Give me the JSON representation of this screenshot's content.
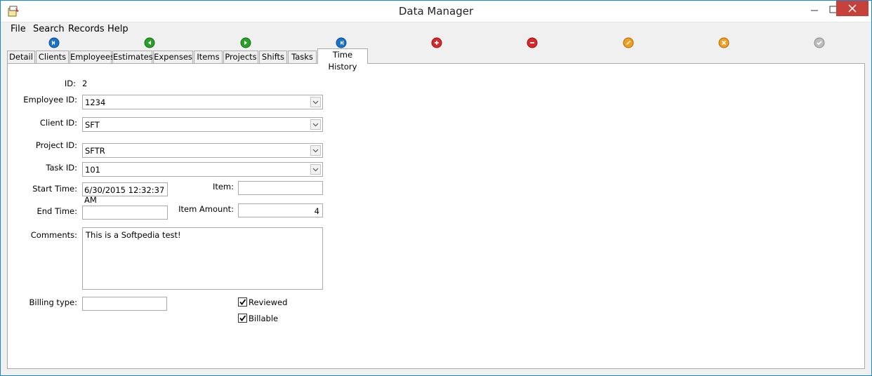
{
  "window": {
    "title": "Data Manager"
  },
  "menu": [
    "File",
    "Search",
    "Records",
    "Help"
  ],
  "navbar": [
    {
      "name": "first-record-icon",
      "color": "#1a72c9"
    },
    {
      "name": "previous-record-icon",
      "color": "#2aa02a"
    },
    {
      "name": "next-record-icon",
      "color": "#2aa02a"
    },
    {
      "name": "last-record-icon",
      "color": "#1a72c9"
    },
    {
      "name": "add-record-icon",
      "color": "#d62a2a"
    },
    {
      "name": "delete-record-icon",
      "color": "#d62a2a"
    },
    {
      "name": "edit-record-icon",
      "color": "#f0a020"
    },
    {
      "name": "cancel-edit-icon",
      "color": "#f0a020"
    },
    {
      "name": "save-record-icon",
      "color": "#a8a8a8"
    }
  ],
  "tabs": [
    "Detail",
    "Clients",
    "Employees",
    "Estimates",
    "Expenses",
    "Items",
    "Projects",
    "Shifts",
    "Tasks",
    "Time History"
  ],
  "active_tab": "Time History",
  "form": {
    "id_label": "ID:",
    "id_value": "2",
    "employee_label": "Employee ID:",
    "employee_value": "1234",
    "client_label": "Client ID:",
    "client_value": "SFT",
    "project_label": "Project ID:",
    "project_value": "SFTR",
    "task_label": "Task ID:",
    "task_value": "101",
    "start_label": "Start Time:",
    "start_value": "6/30/2015 12:32:37 AM",
    "end_label": "End Time:",
    "end_value": "",
    "item_label": "Item:",
    "item_value": "",
    "item_amount_label": "Item Amount:",
    "item_amount_value": "4",
    "comments_label": "Comments:",
    "comments_value": "This is a Softpedia test!",
    "billing_label": "Billing type:",
    "billing_value": "",
    "reviewed_label": "Reviewed",
    "reviewed_checked": true,
    "billable_label": "Billable",
    "billable_checked": true
  }
}
